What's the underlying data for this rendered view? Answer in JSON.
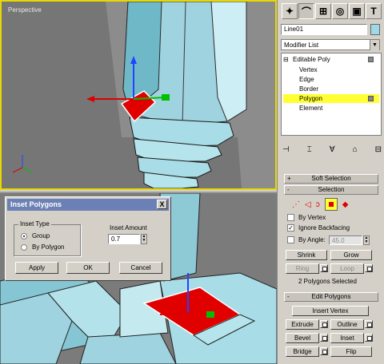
{
  "viewport_top": {
    "label": "Perspective"
  },
  "panel": {
    "tabs": [
      "create-tab",
      "modify-tab",
      "hierarchy-tab",
      "motion-tab",
      "display-tab",
      "utilities-tab"
    ],
    "object_name": "Line01",
    "modifier_list": "Modifier List",
    "stack": {
      "root": "Editable Poly",
      "items": [
        "Vertex",
        "Edge",
        "Border",
        "Polygon",
        "Element"
      ],
      "selected": "Polygon",
      "highlight_color": "#ffff33"
    },
    "soft_selection": {
      "sign": "+",
      "label": "Soft Selection"
    },
    "selection": {
      "sign": "-",
      "label": "Selection",
      "by_vertex": "By Vertex",
      "ignore_backfacing": "Ignore Backfacing",
      "ignore_backfacing_mark": "✓",
      "by_angle": "By Angle:",
      "angle_value": "45.0",
      "shrink": "Shrink",
      "grow": "Grow",
      "ring": "Ring",
      "loop": "Loop",
      "status": "2 Polygons Selected"
    },
    "edit_polygons": {
      "sign": "-",
      "label": "Edit Polygons",
      "insert_vertex": "Insert Vertex",
      "extrude": "Extrude",
      "outline": "Outline",
      "bevel": "Bevel",
      "inset": "Inset",
      "bridge": "Bridge",
      "flip": "Flip"
    }
  },
  "dialog": {
    "title": "Inset Polygons",
    "close": "X",
    "inset_type": {
      "label": "Inset Type",
      "group": "Group",
      "by_polygon": "By Polygon",
      "selected": "Group"
    },
    "inset_amount": {
      "label": "Inset Amount",
      "value": "0.7"
    },
    "apply": "Apply",
    "ok": "OK",
    "cancel": "Cancel",
    "title_color": "#6b80b4"
  },
  "colors": {
    "viewport_active_border": "#e8d800",
    "selection_red": "#e00000",
    "mesh": "#a8dde8"
  }
}
